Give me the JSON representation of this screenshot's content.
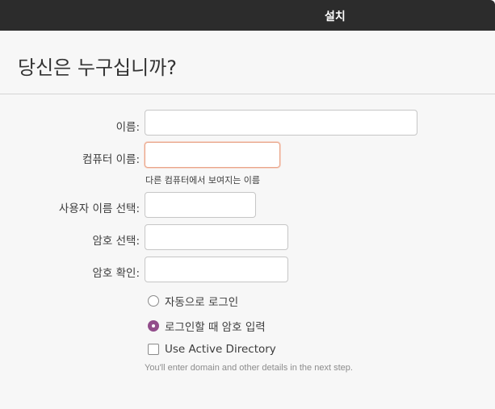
{
  "window": {
    "title": "설치"
  },
  "page": {
    "heading": "당신은 누구십니까?"
  },
  "form": {
    "name": {
      "label": "이름:",
      "value": ""
    },
    "computer_name": {
      "label": "컴퓨터 이름:",
      "value": "",
      "hint": "다른 컴퓨터에서 보여지는 이름"
    },
    "username": {
      "label": "사용자 이름 선택:",
      "value": ""
    },
    "password": {
      "label": "암호 선택:",
      "value": ""
    },
    "password_confirm": {
      "label": "암호 확인:",
      "value": ""
    },
    "login_options": [
      {
        "label": "자동으로 로그인",
        "checked": false
      },
      {
        "label": "로그인할 때 암호 입력",
        "checked": true
      }
    ],
    "active_directory": {
      "label": "Use Active Directory",
      "checked": false,
      "note": "You'll enter domain and other details in the next step."
    }
  },
  "colors": {
    "titlebar": "#2c2c2c",
    "accent": "#924d8b",
    "focus_border": "#e9a58a"
  }
}
